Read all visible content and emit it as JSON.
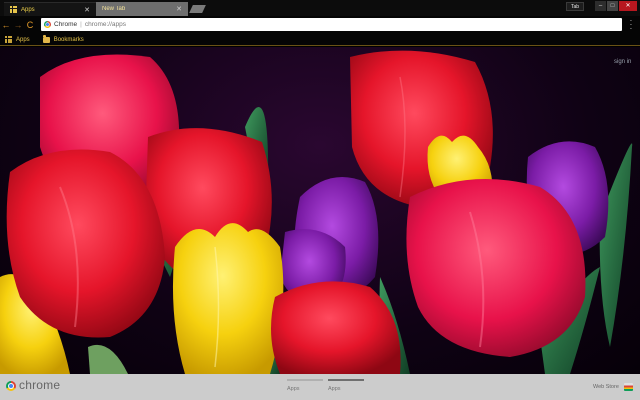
{
  "tabs": [
    {
      "label": "Apps",
      "active": true
    },
    {
      "label": "New Tab",
      "active": false
    }
  ],
  "window": {
    "profile": "Tab",
    "minimize": "–",
    "maximize": "□",
    "close": "✕"
  },
  "toolbar": {
    "back": "←",
    "forward": "→",
    "reload": "C",
    "omnibox_site": "Chrome",
    "omnibox_url": "chrome://apps",
    "menu": "⋮"
  },
  "bookmarks": {
    "apps_label": "Apps",
    "folder_label": "Bookmarks"
  },
  "content": {
    "signin": "sign in"
  },
  "bottom_bar": {
    "brand": "chrome",
    "pages": [
      "Apps",
      "Apps"
    ],
    "webstore": "Web Store"
  },
  "colors": {
    "accent_gold": "#e6c44a",
    "close_red": "#b7171f",
    "tulip_red": "#e5152a",
    "tulip_yellow": "#f6d10f",
    "tulip_purple": "#7b1ca6"
  }
}
